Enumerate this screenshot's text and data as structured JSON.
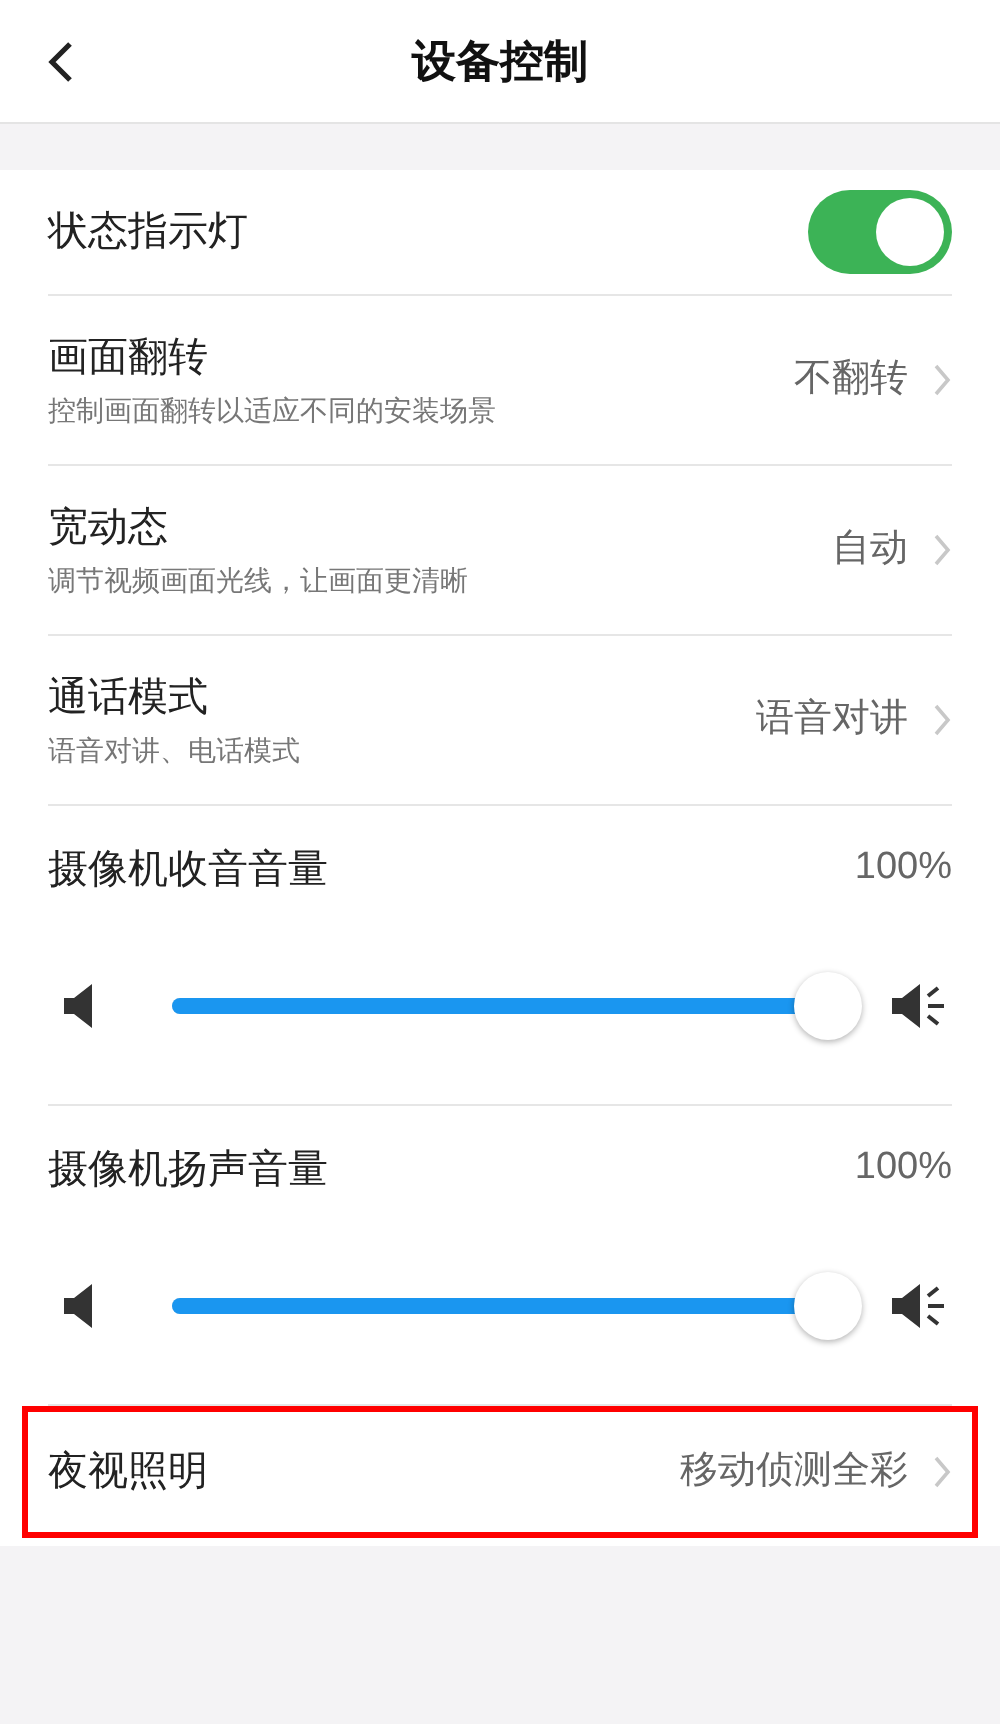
{
  "header": {
    "title": "设备控制"
  },
  "items": [
    {
      "kind": "toggle",
      "label": "状态指示灯",
      "on": true
    },
    {
      "kind": "nav",
      "label": "画面翻转",
      "description": "控制画面翻转以适应不同的安装场景",
      "value": "不翻转"
    },
    {
      "kind": "nav",
      "label": "宽动态",
      "description": "调节视频画面光线，让画面更清晰",
      "value": "自动"
    },
    {
      "kind": "nav",
      "label": "通话模式",
      "description": "语音对讲、电话模式",
      "value": "语音对讲"
    },
    {
      "kind": "volume",
      "label": "摄像机收音音量",
      "reading": "100%",
      "level": 1
    },
    {
      "kind": "volume",
      "label": "摄像机扬声音量",
      "reading": "100%",
      "level": 1
    },
    {
      "kind": "nav",
      "label": "夜视照明",
      "value": "移动侦测全彩",
      "highlighted": true
    }
  ]
}
